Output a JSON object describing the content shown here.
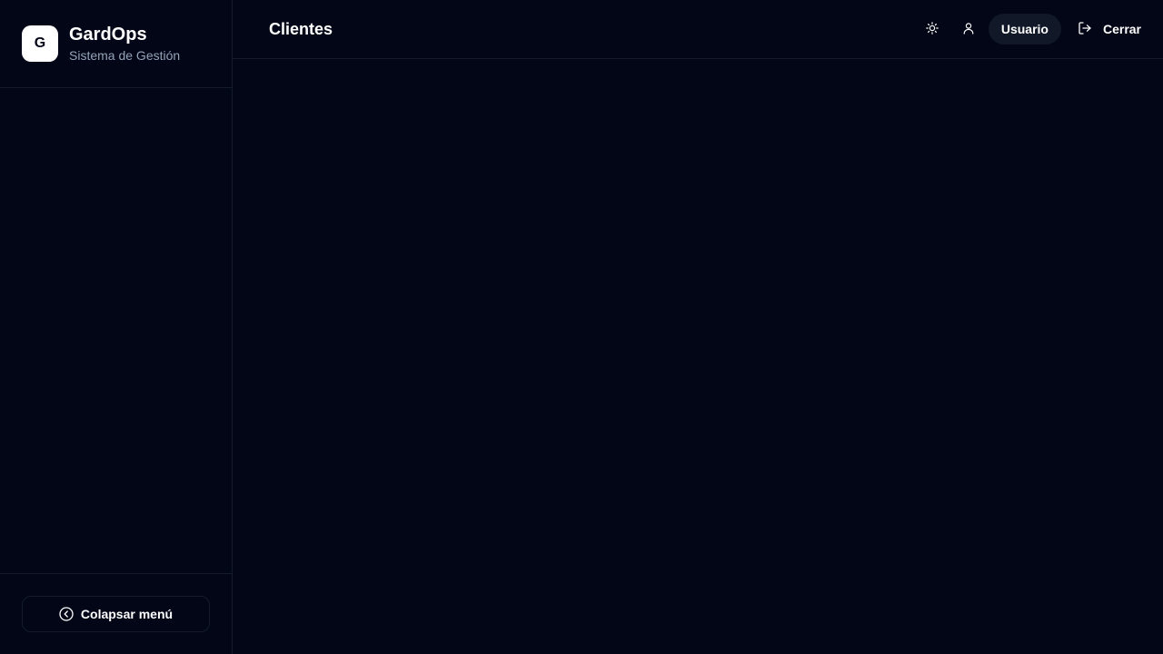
{
  "brand": {
    "logo_letter": "G",
    "name": "GardOps",
    "subtitle": "Sistema de Gestión"
  },
  "sidebar": {
    "collapse_label": "Colapsar menú",
    "collapse_icon": "chevron-left-circle-icon"
  },
  "header": {
    "title": "Clientes",
    "theme_icon": "sun-icon",
    "profile_icon": "user-icon",
    "user_label": "Usuario",
    "logout_icon": "logout-icon",
    "logout_label": "Cerrar"
  },
  "colors": {
    "background": "#020617",
    "border": "#141c2c",
    "pill": "#111827",
    "muted_text": "#94a3b8",
    "text": "#ffffff"
  }
}
